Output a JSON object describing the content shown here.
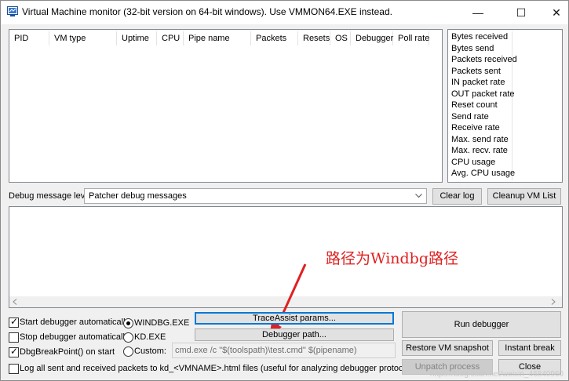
{
  "window": {
    "title": "Virtual Machine monitor (32-bit version on 64-bit windows). Use VMMON64.EXE instead.",
    "minimize": "—",
    "maximize": "☐",
    "close": "✕"
  },
  "process_list": {
    "columns": [
      "PID",
      "VM type",
      "Uptime",
      "CPU",
      "Pipe name",
      "Packets",
      "Resets",
      "OS",
      "Debugger",
      "Poll rate"
    ]
  },
  "stats": {
    "rows": [
      "Bytes received",
      "Bytes send",
      "Packets received",
      "Packets sent",
      "IN packet rate",
      "OUT packet rate",
      "Reset count",
      "Send rate",
      "Receive rate",
      "Max. send rate",
      "Max. recv. rate",
      "CPU usage",
      "Avg. CPU usage"
    ]
  },
  "debug": {
    "level_label": "Debug message level:",
    "level_value": "Patcher debug messages",
    "clear_log": "Clear log",
    "cleanup": "Cleanup VM List"
  },
  "options": {
    "start_debugger": "Start debugger automatically",
    "stop_debugger": "Stop debugger automatically",
    "dbg_breakpoint": "DbgBreakPoint() on start",
    "log_packets": "Log all sent and received packets to kd_<VMNAME>.html files (useful for analyzing debugger protocol)",
    "start_checked": true,
    "stop_checked": false,
    "dbg_checked": true,
    "log_checked": false
  },
  "debugger_choice": {
    "windbg": "WINDBG.EXE",
    "kd": "KD.EXE",
    "custom": "Custom:",
    "selected": "WINDBG.EXE",
    "custom_command": "cmd.exe /c \"$(toolspath)\\test.cmd\" $(pipename)"
  },
  "buttons": {
    "trace_assist": "TraceAssist params...",
    "debugger_path": "Debugger path...",
    "run_debugger": "Run debugger",
    "restore_snapshot": "Restore VM snapshot",
    "instant_break": "Instant break",
    "unpatch": "Unpatch process",
    "close": "Close"
  },
  "annotation": {
    "text": "路径为Windbg路径",
    "color": "#e02020"
  },
  "watermark": "https://blog.csdn.net/weixin_46840960"
}
